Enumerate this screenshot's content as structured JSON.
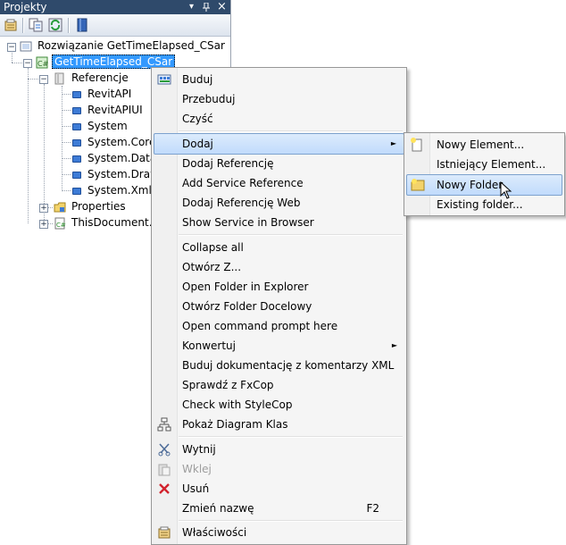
{
  "panel": {
    "title": "Projekty",
    "title_controls": {
      "dropdown": "▾",
      "pin": "ᵖ",
      "close": "×"
    }
  },
  "toolbar": {
    "icons": [
      "properties-icon",
      "show-all-files-icon",
      "refresh-icon",
      "class-view-icon"
    ]
  },
  "tree": {
    "solution": {
      "label": "Rozwiązanie GetTimeElapsed_CSar",
      "expander": "−"
    },
    "project": {
      "label": "GetTimeElapsed_CSar",
      "expander": "−"
    },
    "references": {
      "label": "Referencje",
      "expander": "−",
      "items": [
        "RevitAPI",
        "RevitAPIUI",
        "System",
        "System.Core",
        "System.Data",
        "System.Draw",
        "System.Xml"
      ]
    },
    "properties": {
      "label": "Properties",
      "expander": "+"
    },
    "thisdocument": {
      "label": "ThisDocument.c",
      "expander": "+"
    }
  },
  "context_menu": {
    "build": "Buduj",
    "rebuild": "Przebuduj",
    "clean": "Czyść",
    "add": "Dodaj",
    "add_reference": "Dodaj Referencję",
    "add_service_reference": "Add Service Reference",
    "add_web_reference": "Dodaj Referencję Web",
    "show_service": "Show Service in Browser",
    "collapse_all": "Collapse all",
    "open_with": "Otwórz Z...",
    "open_folder_explorer": "Open Folder in Explorer",
    "open_target_folder": "Otwórz Folder Docelowy",
    "open_cmd": "Open command prompt here",
    "convert": "Konwertuj",
    "build_docs": "Buduj dokumentację z komentarzy XML",
    "fxcop": "Sprawdź z FxCop",
    "stylecop": "Check with StyleCop",
    "class_diagram": "Pokaż Diagram Klas",
    "cut": "Wytnij",
    "paste": "Wklej",
    "remove": "Usuń",
    "rename": "Zmień nazwę",
    "rename_shortcut": "F2",
    "properties": "Właściwości",
    "submenu_arrow": "►"
  },
  "submenu": {
    "new_item": "Nowy Element...",
    "existing_item": "Istniejący Element...",
    "new_folder": "Nowy Folder",
    "existing_folder": "Existing folder..."
  },
  "colors": {
    "title_bar": "#2f4a6b",
    "selection": "#3399ff",
    "menu_highlight": "#c1dbfc"
  }
}
